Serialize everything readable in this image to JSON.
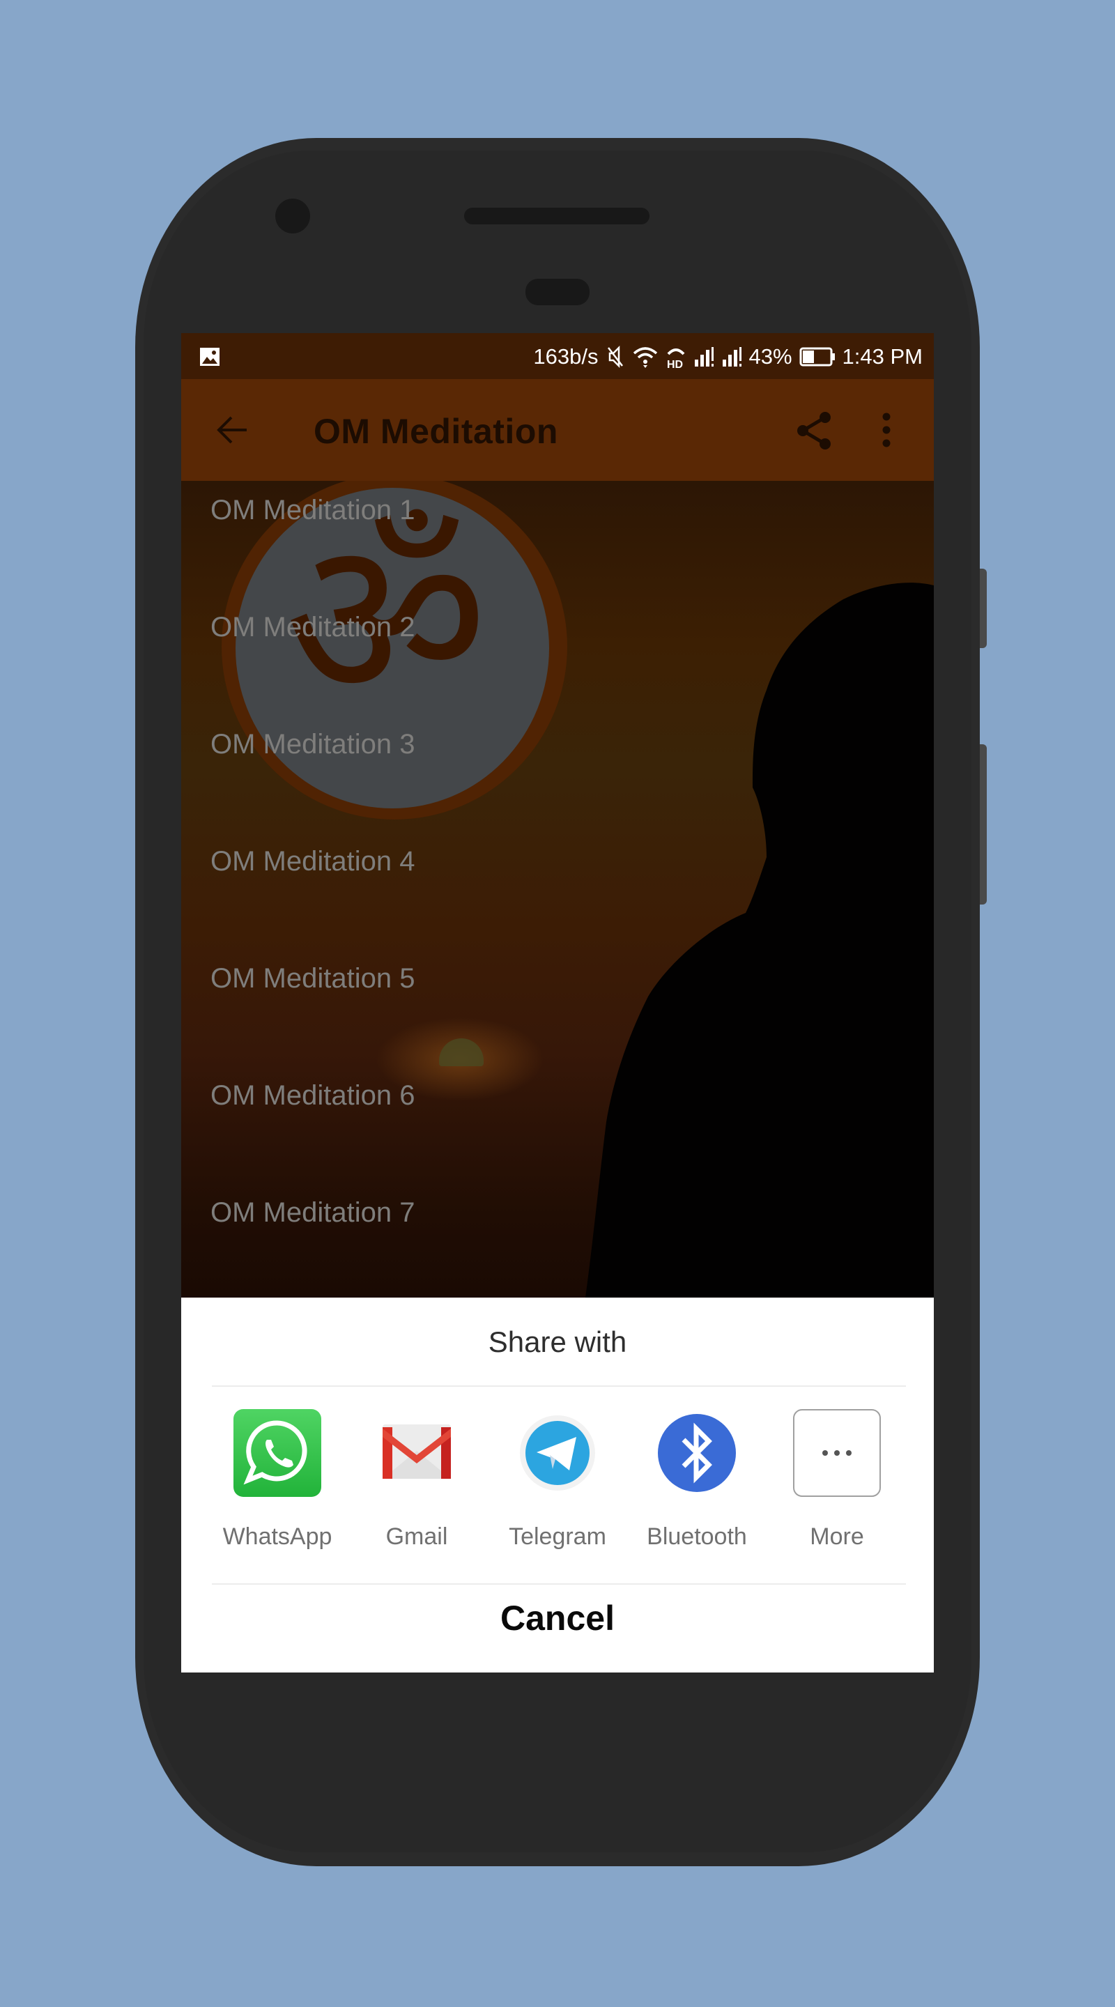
{
  "status_bar": {
    "notification_icon": "image-icon",
    "network_speed": "163b/s",
    "icons": [
      "mute-icon",
      "wifi-icon",
      "hd-call-icon",
      "signal-icon-1",
      "signal-icon-2"
    ],
    "battery_percent": "43%",
    "battery_level": 0.43,
    "time": "1:43 PM"
  },
  "app_bar": {
    "title": "OM Meditation",
    "back_icon": "arrow-left-icon",
    "share_icon": "share-icon",
    "menu_icon": "more-vertical-icon",
    "color": "#5a2805"
  },
  "list": {
    "items": [
      {
        "label": "OM Meditation 1"
      },
      {
        "label": "OM Meditation 2"
      },
      {
        "label": "OM Meditation 3"
      },
      {
        "label": "OM Meditation 4"
      },
      {
        "label": "OM Meditation 5"
      },
      {
        "label": "OM Meditation 6"
      },
      {
        "label": "OM Meditation 7"
      }
    ]
  },
  "share_sheet": {
    "title": "Share with",
    "targets": [
      {
        "label": "WhatsApp",
        "icon": "whatsapp-icon",
        "color": "#25c03e"
      },
      {
        "label": "Gmail",
        "icon": "gmail-icon",
        "color": "#d93025"
      },
      {
        "label": "Telegram",
        "icon": "telegram-icon",
        "color": "#2ca5e0"
      },
      {
        "label": "Bluetooth",
        "icon": "bluetooth-icon",
        "color": "#3367d6"
      },
      {
        "label": "More",
        "icon": "more-horizontal-icon",
        "color": "#666666"
      }
    ],
    "cancel_label": "Cancel"
  }
}
